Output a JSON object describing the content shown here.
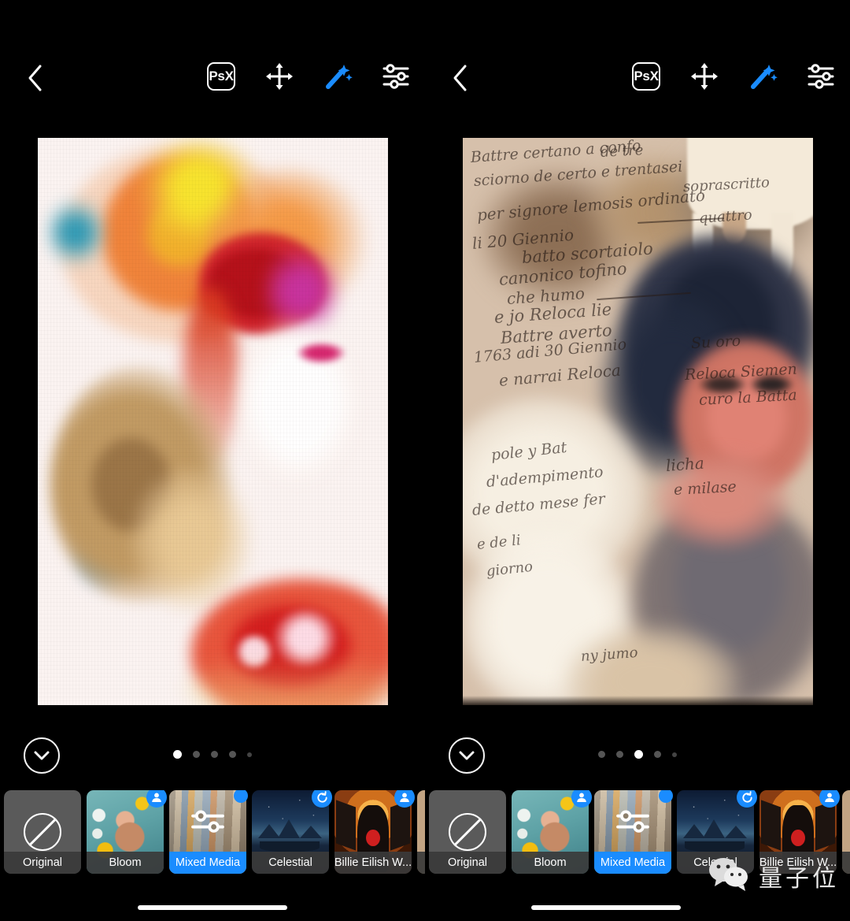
{
  "app": {
    "name": "Photoshop Express",
    "screen": "looks-filter-editor",
    "accent_color": "#1a8cff",
    "background_color": "#000000"
  },
  "panels": [
    {
      "id": "left",
      "toolbar": {
        "back_label": "‹",
        "back_icon": "chevron-left-icon",
        "actions": [
          {
            "label": "PsX",
            "icon": "psx-logo-icon",
            "active": false
          },
          {
            "label": "Move",
            "icon": "move-arrows-icon",
            "active": false
          },
          {
            "label": "Magic",
            "icon": "magic-wand-icon",
            "active": true
          },
          {
            "label": "Adjust",
            "icon": "sliders-icon",
            "active": false
          }
        ]
      },
      "artwork": {
        "name": "watercolor-portrait",
        "description": "Watercolor double-exposure portrait on white paper"
      },
      "pager": {
        "collapse_icon": "chevron-down-circle-icon",
        "dots": 5,
        "active_index": 0
      },
      "filters": [
        {
          "label": "Original",
          "icon": "no-filter-icon",
          "selected": false,
          "badge": null,
          "tile": "original"
        },
        {
          "label": "Bloom",
          "icon": null,
          "selected": false,
          "badge": "person-icon",
          "tile": "bloom"
        },
        {
          "label": "Mixed Media",
          "icon": "sliders-icon",
          "selected": true,
          "badge": "dot",
          "tile": "mixed"
        },
        {
          "label": "Celestial",
          "icon": null,
          "selected": false,
          "badge": "refresh-icon",
          "tile": "celestial"
        },
        {
          "label": "Billie Eilish W...",
          "icon": null,
          "selected": false,
          "badge": "person-icon",
          "tile": "billie"
        },
        {
          "label": "",
          "icon": null,
          "selected": false,
          "badge": null,
          "tile": "vintage"
        }
      ]
    },
    {
      "id": "right",
      "toolbar": {
        "back_label": "‹",
        "back_icon": "chevron-left-icon",
        "actions": [
          {
            "label": "PsX",
            "icon": "psx-logo-icon",
            "active": false
          },
          {
            "label": "Move",
            "icon": "move-arrows-icon",
            "active": false
          },
          {
            "label": "Magic",
            "icon": "magic-wand-icon",
            "active": true
          },
          {
            "label": "Adjust",
            "icon": "sliders-icon",
            "active": false
          }
        ]
      },
      "artwork": {
        "name": "vintage-manuscript-portrait",
        "description": "Vintage parchment manuscript double-exposure portrait"
      },
      "pager": {
        "collapse_icon": "chevron-down-circle-icon",
        "dots": 5,
        "active_index": 2
      },
      "filters": [
        {
          "label": "Original",
          "icon": "no-filter-icon",
          "selected": false,
          "badge": null,
          "tile": "original"
        },
        {
          "label": "Bloom",
          "icon": null,
          "selected": false,
          "badge": "person-icon",
          "tile": "bloom"
        },
        {
          "label": "Mixed Media",
          "icon": "sliders-icon",
          "selected": true,
          "badge": "dot",
          "tile": "mixed"
        },
        {
          "label": "Celestial",
          "icon": null,
          "selected": false,
          "badge": "refresh-icon",
          "tile": "celestial"
        },
        {
          "label": "Billie Eilish W...",
          "icon": null,
          "selected": false,
          "badge": "person-icon",
          "tile": "billie"
        },
        {
          "label": "",
          "icon": null,
          "selected": false,
          "badge": null,
          "tile": "vintage"
        }
      ]
    }
  ],
  "watermark": {
    "icon": "wechat-icon",
    "text": "量子位"
  },
  "system": {
    "home_indicator": true
  }
}
